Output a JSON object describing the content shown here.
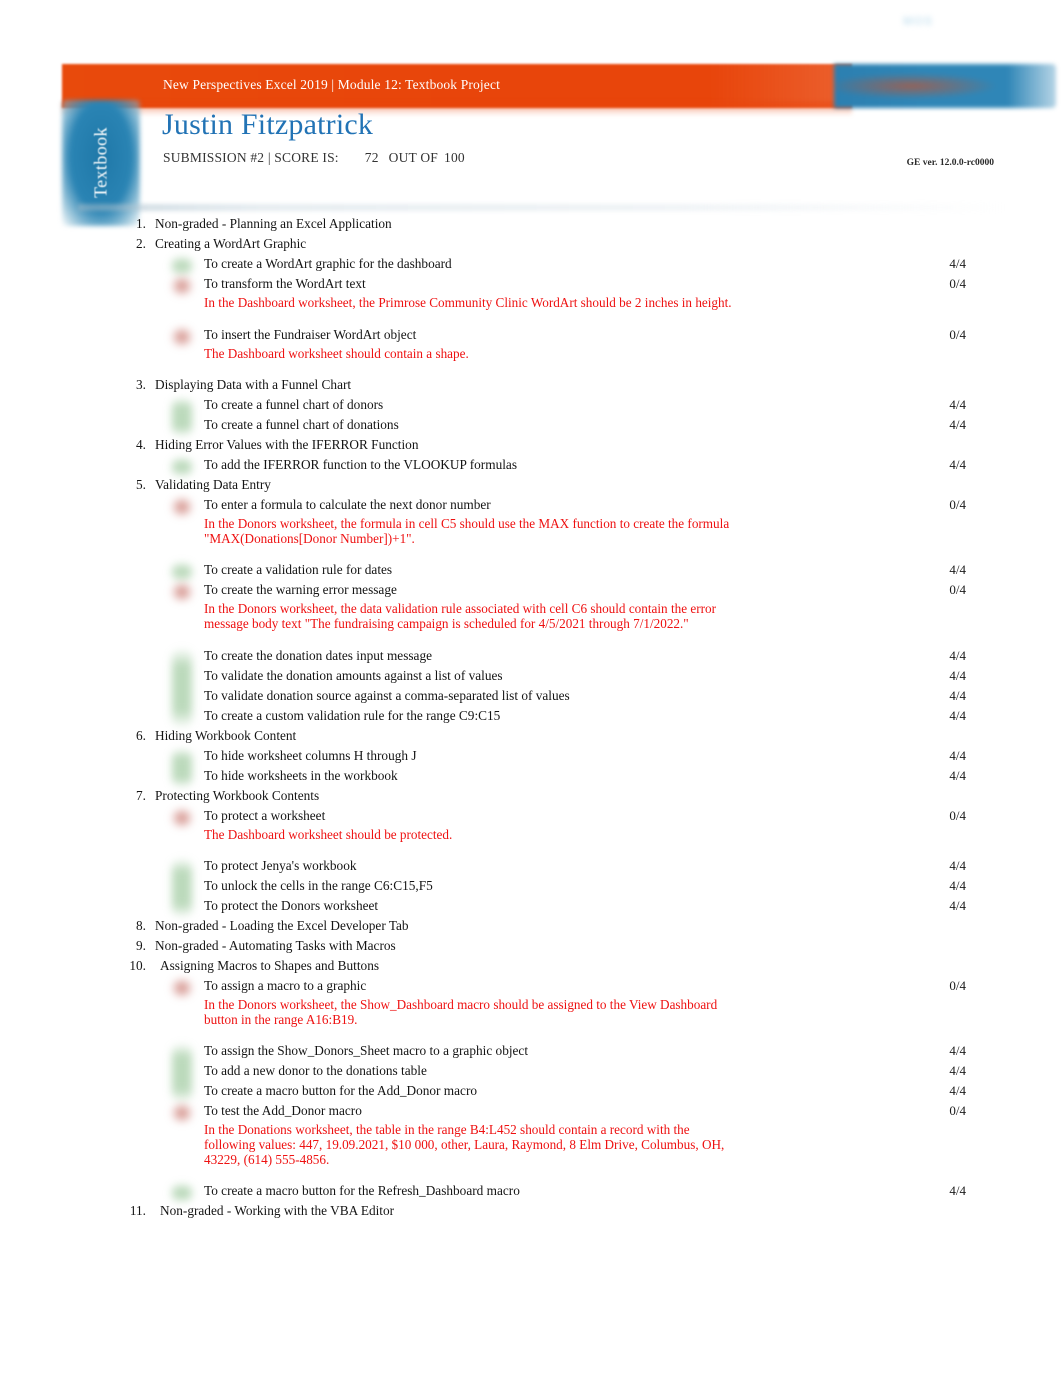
{
  "header": {
    "course_title": "New Perspectives Excel 2019 | Module 12: Textbook Project",
    "logo_mark": "MOS",
    "side_tab_label": "Textbook"
  },
  "student": {
    "name": "Justin Fitzpatrick",
    "submission_label": "SUBMISSION #2 | SCORE IS:",
    "score": "72",
    "out_of_label": "OUT OF",
    "max_score": "100"
  },
  "version_text": "GE ver. 12.0.0-rc0000",
  "colors": {
    "header_orange": "#e8450b",
    "logo_blue": "#2f86b7",
    "name_blue": "#2273b5",
    "feedback_red": "#ee1111",
    "ok_green": "#79b579",
    "bad_red": "#be5a50"
  },
  "sections": [
    {
      "number": "1.",
      "title": "Non-graded - Planning an Excel Application",
      "tasks": []
    },
    {
      "number": "2.",
      "title": "Creating a WordArt Graphic",
      "tasks": [
        {
          "label": "To create a WordArt graphic for the dashboard",
          "score": "4/4",
          "status": "ok"
        },
        {
          "label": "To transform the WordArt text",
          "score": "0/4",
          "status": "bad",
          "feedback": [
            "In the Dashboard worksheet, the Primrose Community Clinic WordArt should be 2 inches in height."
          ]
        },
        {
          "label": "To insert the Fundraiser WordArt object",
          "score": "0/4",
          "status": "bad",
          "feedback": [
            "The Dashboard worksheet should contain a shape."
          ]
        }
      ]
    },
    {
      "number": "3.",
      "title": "Displaying Data with a Funnel Chart",
      "tasks": [
        {
          "label": "To create a funnel chart of donors",
          "score": "4/4",
          "status": "ok"
        },
        {
          "label": "To create a funnel chart of donations",
          "score": "4/4",
          "status": "ok"
        }
      ]
    },
    {
      "number": "4.",
      "title": "Hiding Error Values with the IFERROR Function",
      "tasks": [
        {
          "label": "To add the IFERROR function to the VLOOKUP formulas",
          "score": "4/4",
          "status": "ok"
        }
      ]
    },
    {
      "number": "5.",
      "title": "Validating Data Entry",
      "tasks": [
        {
          "label": "To enter a formula to calculate the next donor number",
          "score": "0/4",
          "status": "bad",
          "feedback": [
            "In the Donors worksheet, the formula in cell C5 should use the MAX function to create the formula",
            "\"MAX(Donations[Donor Number])+1\"."
          ]
        },
        {
          "label": "To create a validation rule for dates",
          "score": "4/4",
          "status": "ok"
        },
        {
          "label": "To create the warning error message",
          "score": "0/4",
          "status": "bad",
          "feedback": [
            "In the Donors worksheet, the data validation rule associated with cell C6 should contain the error",
            "message body text \"The fundraising campaign is scheduled for 4/5/2021 through 7/1/2022.\""
          ]
        },
        {
          "label": "To create the donation dates input message",
          "score": "4/4",
          "status": "ok"
        },
        {
          "label": "To validate the donation amounts against a list of values",
          "score": "4/4",
          "status": "ok"
        },
        {
          "label": "To validate donation source against a comma-separated list of values",
          "score": "4/4",
          "status": "ok"
        },
        {
          "label": "To create a custom validation rule for the range C9:C15",
          "score": "4/4",
          "status": "ok"
        }
      ]
    },
    {
      "number": "6.",
      "title": "Hiding Workbook Content",
      "tasks": [
        {
          "label": "To hide worksheet columns H through J",
          "score": "4/4",
          "status": "ok"
        },
        {
          "label": "To hide worksheets in the workbook",
          "score": "4/4",
          "status": "ok"
        }
      ]
    },
    {
      "number": "7.",
      "title": "Protecting Workbook Contents",
      "tasks": [
        {
          "label": "To protect a worksheet",
          "score": "0/4",
          "status": "bad",
          "feedback": [
            "The Dashboard worksheet should be protected."
          ]
        },
        {
          "label": "To protect Jenya's workbook",
          "score": "4/4",
          "status": "ok"
        },
        {
          "label": "To unlock the cells in the range C6:C15,F5",
          "score": "4/4",
          "status": "ok"
        },
        {
          "label": "To protect the Donors worksheet",
          "score": "4/4",
          "status": "ok"
        }
      ]
    },
    {
      "number": "8.",
      "title": "Non-graded - Loading the Excel Developer Tab",
      "tasks": []
    },
    {
      "number": "9.",
      "title": "Non-graded - Automating Tasks with Macros",
      "tasks": []
    },
    {
      "number": "10.",
      "title": "Assigning Macros to Shapes and Buttons",
      "tasks": [
        {
          "label": "To assign a macro to a graphic",
          "score": "0/4",
          "status": "bad",
          "feedback": [
            "In the Donors worksheet, the Show_Dashboard macro should be assigned to the View Dashboard",
            "button in the range A16:B19."
          ]
        },
        {
          "label": "To assign the Show_Donors_Sheet macro to a graphic object",
          "score": "4/4",
          "status": "ok"
        },
        {
          "label": "To add a new donor to the donations table",
          "score": "4/4",
          "status": "ok"
        },
        {
          "label": "To create a macro button for the Add_Donor macro",
          "score": "4/4",
          "status": "ok"
        },
        {
          "label": "To test the Add_Donor macro",
          "score": "0/4",
          "status": "bad",
          "feedback": [
            "In the Donations worksheet, the table in the range B4:L452 should contain a record with the",
            "following values: 447, 19.09.2021, $10 000, other, Laura, Raymond, 8 Elm Drive, Columbus, OH,",
            "43229, (614) 555-4856."
          ]
        },
        {
          "label": "To create a macro button for the Refresh_Dashboard macro",
          "score": "4/4",
          "status": "ok"
        }
      ]
    },
    {
      "number": "11.",
      "title": "Non-graded - Working with the VBA Editor",
      "tasks": []
    }
  ]
}
